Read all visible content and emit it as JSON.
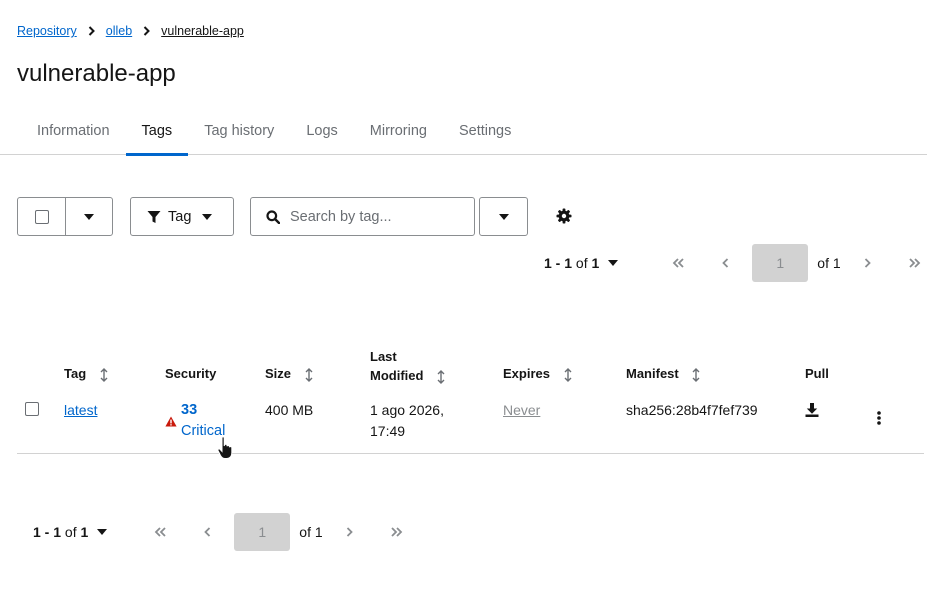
{
  "breadcrumb": {
    "items": [
      "Repository",
      "olleb"
    ],
    "current": "vulnerable-app"
  },
  "page": {
    "title": "vulnerable-app"
  },
  "tabs": [
    {
      "label": "Information"
    },
    {
      "label": "Tags"
    },
    {
      "label": "Tag history"
    },
    {
      "label": "Logs"
    },
    {
      "label": "Mirroring"
    },
    {
      "label": "Settings"
    }
  ],
  "active_tab": "Tags",
  "toolbar": {
    "filter_label": "Tag",
    "search_placeholder": "Search by tag..."
  },
  "pagination_top": {
    "range": "1 - 1",
    "of_word": "of",
    "total": "1",
    "page": "1",
    "of_pages": "of 1"
  },
  "pagination_bottom": {
    "range": "1 - 1",
    "of_word": "of",
    "total": "1",
    "page": "1",
    "of_pages": "of 1"
  },
  "table": {
    "headers": {
      "tag": "Tag",
      "security": "Security",
      "size": "Size",
      "last_modified_1": "Last",
      "last_modified_2": "Modified",
      "expires": "Expires",
      "manifest": "Manifest",
      "pull": "Pull"
    },
    "rows": [
      {
        "tag": "latest",
        "security_count": "33",
        "security_level": "Critical",
        "size": "400 MB",
        "modified_date": "1 ago 2026,",
        "modified_time": "17:49",
        "expires": "Never",
        "manifest": "sha256:28b4f7fef739"
      }
    ]
  },
  "colors": {
    "accent": "#0066cc",
    "critical": "#c9190b",
    "border": "#d2d2d2"
  },
  "icons": [
    "chevron-right-icon",
    "caret-down-icon",
    "filter-icon",
    "search-icon",
    "gear-icon",
    "angle-double-left-icon",
    "angle-left-icon",
    "angle-right-icon",
    "angle-double-right-icon",
    "sort-icon",
    "warning-triangle-icon",
    "download-icon",
    "kebab-icon",
    "pointer-cursor-icon"
  ]
}
